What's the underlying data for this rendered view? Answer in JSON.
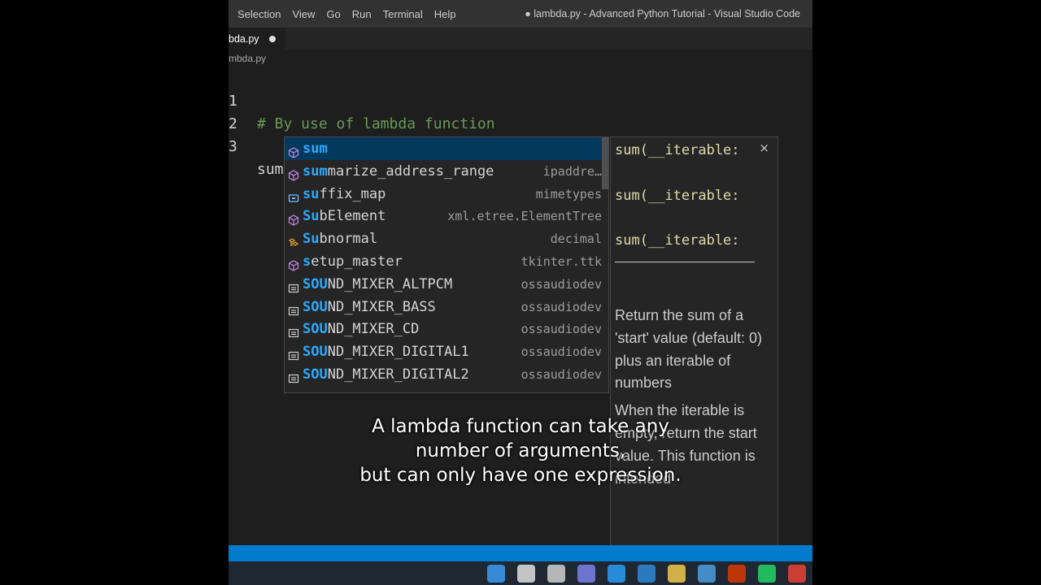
{
  "menu": [
    "Selection",
    "View",
    "Go",
    "Run",
    "Terminal",
    "Help"
  ],
  "window_title": "● lambda.py - Advanced Python Tutorial - Visual Studio Code",
  "tab": {
    "name": "bda.py"
  },
  "breadcrumb": "mbda.py",
  "code_lines": [
    {
      "num": "1",
      "text": "# By use of lambda function"
    },
    {
      "num": "2",
      "text": ""
    },
    {
      "num": "3",
      "text": "sum"
    }
  ],
  "suggestions": [
    {
      "pre": "",
      "match": "sum",
      "rest": "",
      "detail": "",
      "icon": "cube-icon"
    },
    {
      "pre": "",
      "match": "sum",
      "rest": "marize_address_range",
      "detail": "ipaddre…",
      "icon": "cube-icon"
    },
    {
      "pre": "",
      "match": "su",
      "rest": "ffix_map",
      "detail": "mimetypes",
      "icon": "variable-icon"
    },
    {
      "pre": "",
      "match": "Su",
      "rest": "bElement",
      "detail": "xml.etree.ElementTree",
      "icon": "cube-icon"
    },
    {
      "pre": "",
      "match": "Su",
      "rest": "bnormal",
      "detail": "decimal",
      "icon": "class-icon"
    },
    {
      "pre": "",
      "match": "s",
      "rest": "etup_master",
      "detail": "tkinter.ttk",
      "icon": "cube-icon"
    },
    {
      "pre": "",
      "match": "SOU",
      "rest": "ND_MIXER_ALTPCM",
      "detail": "ossaudiodev",
      "icon": "constant-icon"
    },
    {
      "pre": "",
      "match": "SOU",
      "rest": "ND_MIXER_BASS",
      "detail": "ossaudiodev",
      "icon": "constant-icon"
    },
    {
      "pre": "",
      "match": "SOU",
      "rest": "ND_MIXER_CD",
      "detail": "ossaudiodev",
      "icon": "constant-icon"
    },
    {
      "pre": "",
      "match": "SOU",
      "rest": "ND_MIXER_DIGITAL1",
      "detail": "ossaudiodev",
      "icon": "constant-icon"
    },
    {
      "pre": "",
      "match": "SOU",
      "rest": "ND_MIXER_DIGITAL2",
      "detail": "ossaudiodev",
      "icon": "constant-icon"
    }
  ],
  "details": {
    "signatures": [
      "sum(__iterable:",
      "sum(__iterable:",
      "sum(__iterable:"
    ],
    "close": "×",
    "doc": [
      "Return the sum of a 'start' value (default: 0) plus an iterable of numbers",
      "When the iterable is empty, return the start value. This function is intended"
    ]
  },
  "caption": [
    "A lambda function can take any",
    "number of arguments,",
    "but can only have one expression."
  ],
  "colors": {
    "accent": "#007acc",
    "match": "#2aaaff",
    "comment": "#6a9955",
    "selected": "#04395e"
  },
  "taskbar_icons": [
    "windows-icon",
    "search-icon",
    "taskview-icon",
    "teams-icon",
    "edge-icon",
    "app-l-icon",
    "explorer-icon",
    "mail-icon",
    "office-icon",
    "whatsapp-icon",
    "chrome-icon"
  ]
}
